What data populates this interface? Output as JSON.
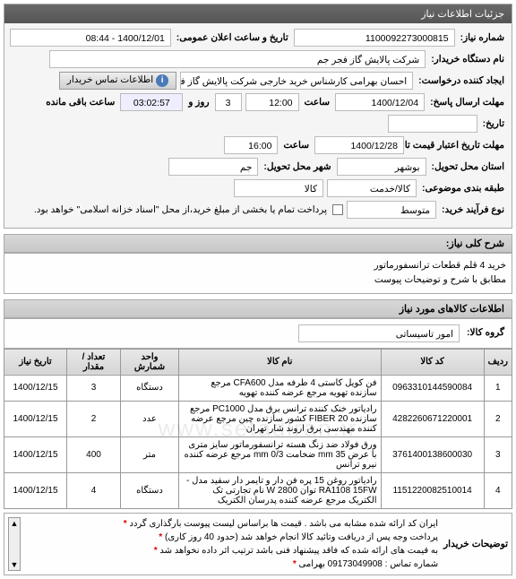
{
  "panel_title": "جزئیات اطلاعات نیاز",
  "fields": {
    "need_no_label": "شماره نیاز:",
    "need_no": "1100092273000815",
    "announce_label": "تاریخ و ساعت اعلان عمومی:",
    "announce": "1400/12/01 - 08:44",
    "buyer_org_label": "نام دستگاه خریدار:",
    "buyer_org": "شرکت پالایش گاز فجر جم",
    "requester_label": "ایجاد کننده درخواست:",
    "requester": "احسان بهرامی کارشناس خرید خارجی شرکت پالایش گاز فجر جم",
    "contact_btn": "اطلاعات تماس خریدار",
    "resp_deadline_label": "مهلت ارسال پاسخ:",
    "resp_deadline_date": "1400/12/04",
    "resp_deadline_time": "12:00",
    "time_label": "ساعت",
    "days_left": "3",
    "days_left_label": "روز و",
    "countdown": "03:02:57",
    "countdown_label": "ساعت باقی مانده",
    "history_label": "تاریخ:",
    "cred_deadline_label": "مهلت تاریخ اعتبار قیمت تا تاریخ:",
    "cred_deadline_date": "1400/12/28",
    "cred_deadline_time": "16:00",
    "province_label": "استان محل تحویل:",
    "province": "بوشهر",
    "city_label": "شهر محل تحویل:",
    "city": "جم",
    "category_label": "طبقه بندی موضوعی:",
    "cat1": "کالا/خدمت",
    "cat2": "کالا",
    "purchase_type_label": "نوع فرآیند خرید:",
    "purchase_type": "متوسط",
    "payment_note": "پرداخت تمام یا بخشی از مبلغ خرید،از محل \"اسناد خزانه اسلامی\" خواهد بود."
  },
  "need_desc": {
    "title": "شرح کلی نیاز:",
    "line1": "خرید 4 قلم قطعات ترانسفورماتور",
    "line2": "مطابق با شرح و توضیحات پیوست"
  },
  "items_section": "اطلاعات کالاهای مورد نیاز",
  "group_label": "گروه کالا:",
  "group_value": "امور تاسیساتی",
  "table": {
    "headers": [
      "ردیف",
      "کد کالا",
      "نام کالا",
      "واحد شمارش",
      "تعداد / مقدار",
      "تاریخ نیاز"
    ],
    "rows": [
      {
        "n": "1",
        "code": "0963310144590084",
        "name": "فن کویل کاستی 4 طرفه مدل CFA600 مرجع سازنده تهویه مرجع عرضه کننده تهویه",
        "unit": "دستگاه",
        "qty": "3",
        "date": "1400/12/15"
      },
      {
        "n": "2",
        "code": "4282260671220001",
        "name": "رادیاتور خنک کننده ترانس برق مدل PC1000 مرجع سازنده 20 FIBER کشور سازنده چین مرجع عرضه کننده مهندسی برق اروند شار تهران",
        "unit": "عدد",
        "qty": "2",
        "date": "1400/12/15"
      },
      {
        "n": "3",
        "code": "3761400138600030",
        "name": "ورق فولاد ضد زنگ هسته ترانسفورماتور سایز متری با عرض 35 mm ضخامت 0/3 mm مرجع عرضه کننده نیرو ترانس",
        "unit": "متر",
        "qty": "400",
        "date": "1400/12/15"
      },
      {
        "n": "4",
        "code": "1151220082510014",
        "name": "رادیاتور روغن 15 پره فن دار و تایمر دار سفید مدل -RA1108 15FW توان 2800 W نام تجارتی تک الکتریک مرجع عرضه کننده پدرسان الکتریک",
        "unit": "دستگاه",
        "qty": "4",
        "date": "1400/12/15"
      }
    ]
  },
  "watermark": "www.setadiran.ir",
  "notes": {
    "label": "توضیحات خریدار",
    "l1": "ایران کد ارائه شده مشابه می باشد . قیمت ها براساس لیست پیوست بارگذاری گردد",
    "l2": "پرداخت وجه پس از دریافت وتائید کالا انجام خواهد شد (حدود 40 روز کاری)",
    "l3": "به قیمت های ارائه شده که فاقد پیشنهاد فنی باشد ترتیب اثر داده نخواهد شد",
    "l4": "شماره تماس : 09173049908 بهرامی",
    "star": "*"
  }
}
